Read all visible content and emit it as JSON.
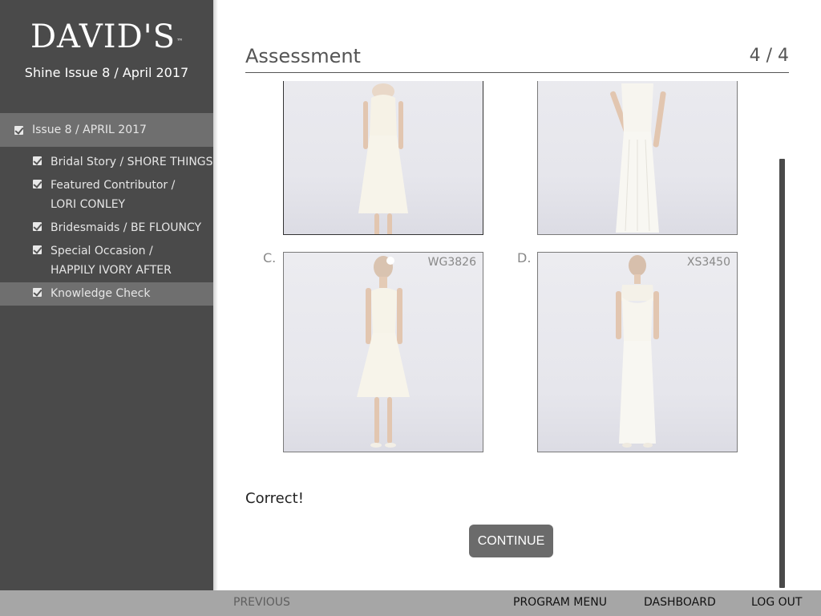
{
  "sidebar": {
    "logo_text": "DAVID'S",
    "logo_mark": "™",
    "subtitle": "Shine Issue 8 / April 2017",
    "main_item": "Issue 8 / APRIL 2017",
    "items": [
      {
        "label": "Bridal Story / SHORE THINGS"
      },
      {
        "label": "Featured Contributor / LORI CONLEY"
      },
      {
        "label": "Bridesmaids / BE FLOUNCY"
      },
      {
        "label": "Special Occasion / HAPPILY IVORY AFTER"
      },
      {
        "label": "Knowledge Check"
      }
    ]
  },
  "header": {
    "title": "Assessment",
    "counter": "4 / 4"
  },
  "options": [
    {
      "letter": "",
      "sku": ""
    },
    {
      "letter": "",
      "sku": ""
    },
    {
      "letter": "C.",
      "sku": "WG3826"
    },
    {
      "letter": "D.",
      "sku": "XS3450"
    }
  ],
  "feedback": "Correct!",
  "continue_label": "CONTINUE",
  "footer": {
    "previous": "PREVIOUS",
    "program_menu": "PROGRAM MENU",
    "dashboard": "DASHBOARD",
    "logout": "LOG OUT"
  },
  "colors": {
    "sidebar_bg": "#4a4a4a",
    "nav_active_bg": "#6f6f6f",
    "footer_bg": "#a6a6a6",
    "button_bg": "#6b6b6b"
  }
}
